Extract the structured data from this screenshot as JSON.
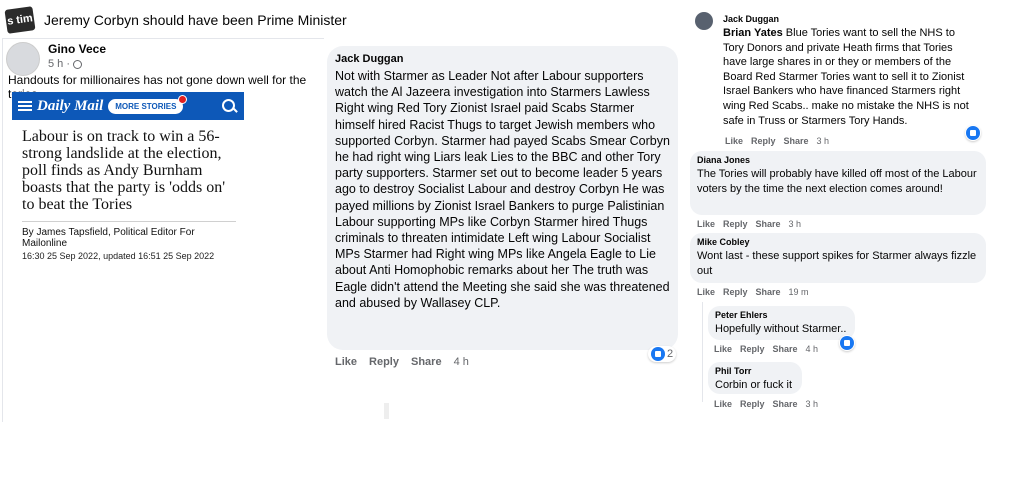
{
  "group": {
    "avatar_text": "s tim",
    "title": "Jeremy Corbyn should have been Prime Minister"
  },
  "post": {
    "author": "Gino Vece",
    "time": "5 h ·",
    "text": "Handouts for millionaires has not gone down well for the tories.",
    "article": {
      "brand": "Daily Mail",
      "more_stories": "MORE STORIES",
      "headline": "Labour is on track to win a 56-strong landslide at the election, poll finds as Andy Burnham boasts that the party is 'odds on' to beat the Tories",
      "byline": "By James Tapsfield, Political Editor For Mailonline",
      "date": "16:30 25 Sep 2022, updated 16:51 25 Sep 2022"
    }
  },
  "main_comment": {
    "author": "Jack Duggan",
    "text": "Not with Starmer as Leader Not after Labour supporters watch the Al Jazeera investigation into Starmers Lawless Right wing Red Tory Zionist Israel paid Scabs Starmer himself hired Racist Thugs to target Jewish members who supported Corbyn. Starmer had payed Scabs Smear Corbyn he had right wing Liars leak Lies to the BBC and other Tory party supporters. Starmer set out to become leader 5 years ago to destroy Socialist Labour and destroy Corbyn He was payed millions by Zionist Israel Bankers to purge Palistinian Labour supporting MPs like Corbyn Starmer hired Thugs criminals to threaten intimidate Left wing Labour Socialist MPs Starmer had Right wing MPs like Angela Eagle to Lie about Anti Homophobic remarks about her The truth was Eagle didn't attend the Meeting she said she was threatened and abused by Wallasey CLP.",
    "reactions": "2",
    "actions": {
      "like": "Like",
      "reply": "Reply",
      "share": "Share",
      "time": "4 h"
    }
  },
  "replies": [
    {
      "author": "Jack Duggan",
      "mention": "Brian Yates",
      "text": " Blue Tories want to sell the NHS to Tory Donors and private Heath firms that Tories have large shares in or they or members of the Board Red Starmer Tories want to sell it to Zionist Israel Bankers who have financed Starmers right wing Red Scabs.. make no mistake the NHS is not safe in Truss or Starmers Tory Hands.",
      "actions": {
        "like": "Like",
        "reply": "Reply",
        "share": "Share",
        "time": "3 h"
      }
    },
    {
      "author": "Diana Jones",
      "text": "The Tories will probably have killed off most of the Labour voters by the time the next election comes around!",
      "actions": {
        "like": "Like",
        "reply": "Reply",
        "share": "Share",
        "time": "3 h"
      }
    },
    {
      "author": "Mike Cobley",
      "text": "Wont last - these support spikes for Starmer always fizzle out",
      "actions": {
        "like": "Like",
        "reply": "Reply",
        "share": "Share",
        "time": "19 m"
      }
    },
    {
      "author": "Peter Ehlers",
      "text": "Hopefully without Starmer..",
      "actions": {
        "like": "Like",
        "reply": "Reply",
        "share": "Share",
        "time": "4 h"
      }
    },
    {
      "author": "Phil Torr",
      "text": "Corbin or fuck it",
      "actions": {
        "like": "Like",
        "reply": "Reply",
        "share": "Share",
        "time": "3 h"
      }
    }
  ],
  "colors": {
    "facebook_blue": "#1877f2",
    "bubble_gray": "#f0f2f5",
    "meta_gray": "#65676b",
    "dailymail_blue": "#0d58b8"
  }
}
